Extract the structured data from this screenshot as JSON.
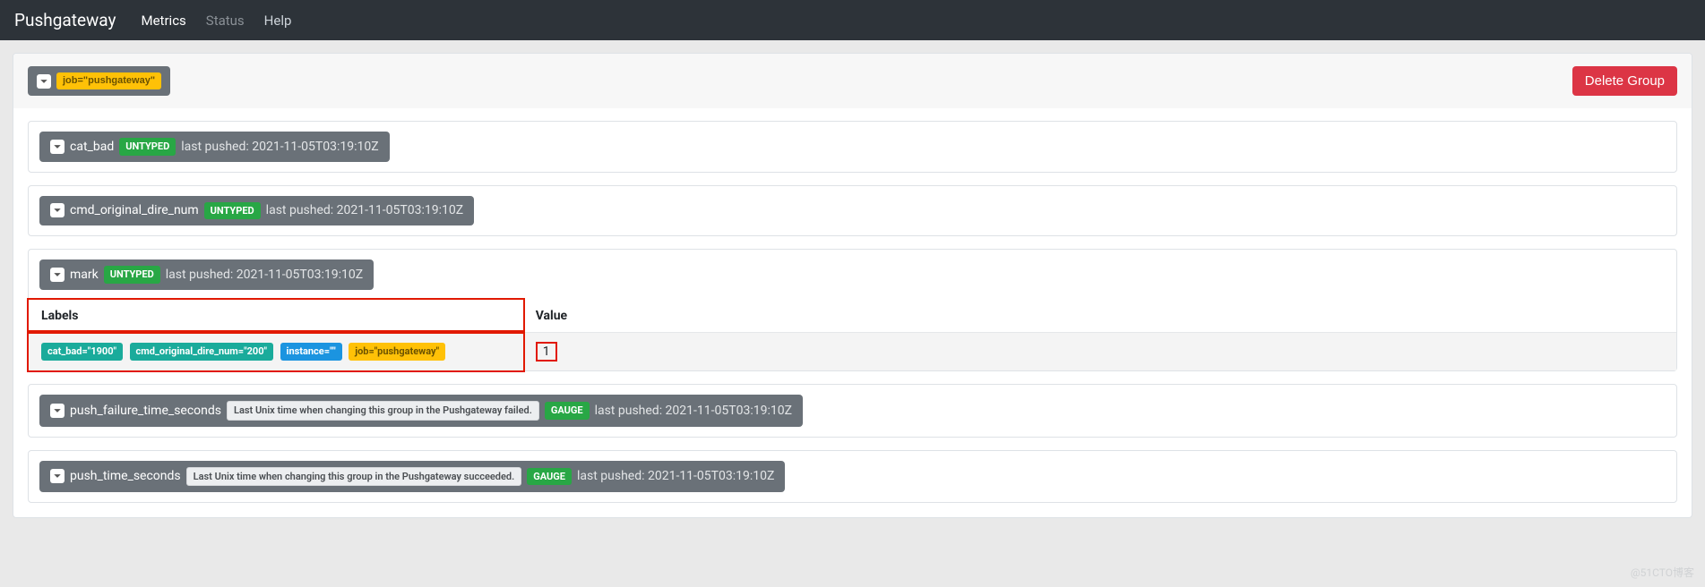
{
  "navbar": {
    "brand": "Pushgateway",
    "links": [
      {
        "label": "Metrics",
        "active": true
      },
      {
        "label": "Status",
        "active": false
      },
      {
        "label": "Help",
        "active": false
      }
    ]
  },
  "group": {
    "label_tag": "job=\"pushgateway\"",
    "delete_label": "Delete Group"
  },
  "metrics": [
    {
      "name": "cat_bad",
      "type_badge": "UNTYPED",
      "pushed": "last pushed: 2021-11-05T03:19:10Z",
      "help": null,
      "expanded": false
    },
    {
      "name": "cmd_original_dire_num",
      "type_badge": "UNTYPED",
      "pushed": "last pushed: 2021-11-05T03:19:10Z",
      "help": null,
      "expanded": false
    },
    {
      "name": "mark",
      "type_badge": "UNTYPED",
      "pushed": "last pushed: 2021-11-05T03:19:10Z",
      "help": null,
      "expanded": true,
      "table": {
        "headers": {
          "labels": "Labels",
          "value": "Value"
        },
        "rows": [
          {
            "labels": [
              {
                "text": "cat_bad=\"1900\"",
                "color": "teal"
              },
              {
                "text": "cmd_original_dire_num=\"200\"",
                "color": "teal"
              },
              {
                "text": "instance=\"\"",
                "color": "blue"
              },
              {
                "text": "job=\"pushgateway\"",
                "color": "yellow"
              }
            ],
            "value": "1"
          }
        ]
      }
    },
    {
      "name": "push_failure_time_seconds",
      "type_badge": "GAUGE",
      "pushed": "last pushed: 2021-11-05T03:19:10Z",
      "help": "Last Unix time when changing this group in the Pushgateway failed.",
      "expanded": false
    },
    {
      "name": "push_time_seconds",
      "type_badge": "GAUGE",
      "pushed": "last pushed: 2021-11-05T03:19:10Z",
      "help": "Last Unix time when changing this group in the Pushgateway succeeded.",
      "expanded": false
    }
  ],
  "watermark": "@51CTO博客"
}
